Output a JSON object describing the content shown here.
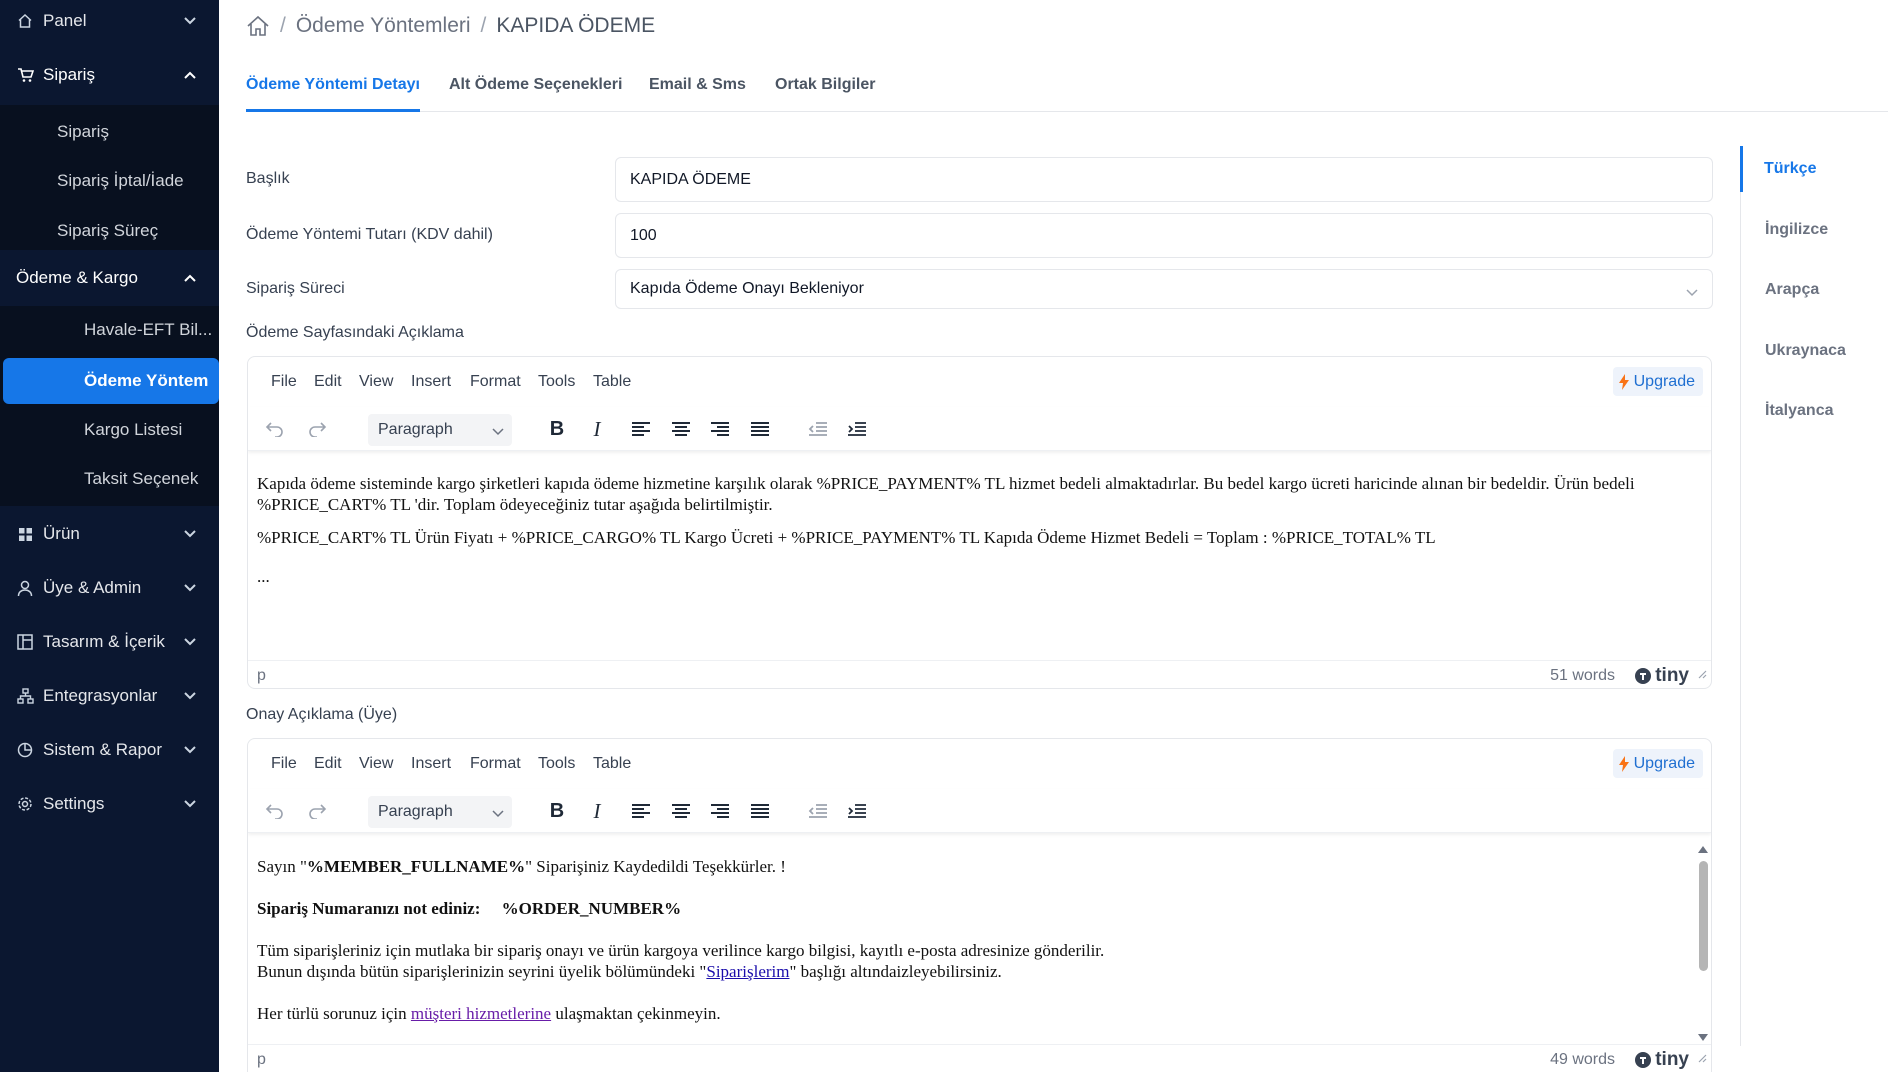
{
  "sidebar": {
    "panel": "Panel",
    "siparis": "Sipariş",
    "siparis_sub": [
      "Sipariş",
      "Sipariş İptal/İade",
      "Sipariş Süreç"
    ],
    "odeme_kargo": "Ödeme & Kargo",
    "odeme_sub": [
      "Havale-EFT Bil...",
      "Ödeme Yöntem",
      "Kargo Listesi",
      "Taksit Seçenek"
    ],
    "urun": "Ürün",
    "uye_admin": "Üye & Admin",
    "tasarim": "Tasarım & İçerik",
    "entegrasyon": "Entegrasyonlar",
    "sistem": "Sistem & Rapor",
    "settings": "Settings"
  },
  "breadcrumb": {
    "parent": "Ödeme Yöntemleri",
    "current": "KAPIDA ÖDEME",
    "sep": "/"
  },
  "tabs": [
    "Ödeme Yöntemi Detayı",
    "Alt Ödeme Seçenekleri",
    "Email & Sms",
    "Ortak Bilgiler"
  ],
  "form": {
    "baslik_label": "Başlık",
    "baslik_value": "KAPIDA ÖDEME",
    "tutar_label": "Ödeme Yöntemi Tutarı (KDV dahil)",
    "tutar_value": "100",
    "surec_label": "Sipariş Süreci",
    "surec_value": "Kapıda Ödeme Onayı Bekleniyor",
    "aciklama_label": "Ödeme Sayfasındaki Açıklama",
    "onay_label": "Onay Açıklama (Üye)"
  },
  "editor_common": {
    "menus": [
      "File",
      "Edit",
      "View",
      "Insert",
      "Format",
      "Tools",
      "Table"
    ],
    "upgrade": "Upgrade",
    "block_format": "Paragraph",
    "path": "p",
    "brand": "tiny"
  },
  "editor1": {
    "p1": "Kapıda ödeme sisteminde kargo şirketleri kapıda ödeme hizmetine karşılık olarak %PRICE_PAYMENT% TL hizmet bedeli almaktadırlar. Bu bedel kargo ücreti haricinde alınan bir bedeldir. Ürün bedeli %PRICE_CART% TL 'dir. Toplam ödeyeceğiniz tutar aşağıda belirtilmiştir.",
    "p2": "%PRICE_CART% TL Ürün Fiyatı + %PRICE_CARGO% TL Kargo Ücreti  + %PRICE_PAYMENT% TL Kapıda Ödeme Hizmet Bedeli = Toplam : %PRICE_TOTAL% TL",
    "p3": "...",
    "words": "51 words"
  },
  "editor2": {
    "l1_a": "Sayın \"",
    "l1_b": "%MEMBER_FULLNAME%",
    "l1_c": "\" Siparişiniz Kaydedildi Teşekkürler. !",
    "l2": "Sipariş Numaranızı not ediniz:     %ORDER_NUMBER%",
    "l3": "Tüm siparişleriniz için mutlaka bir sipariş onayı ve ürün kargoya verilince kargo bilgisi, kayıtlı e-posta adresinize gönderilir.",
    "l4_a": "Bunun dışında bütün siparişlerinizin seyrini üyelik bölümündeki \"",
    "l4_link": "Siparişlerim",
    "l4_b": "\" başlığı altındaizleyebilirsiniz.",
    "l5_a": "Her türlü sorunuz için ",
    "l5_link": "müşteri hizmetlerine",
    "l5_b": " ulaşmaktan çekinmeyin.",
    "words": "49 words"
  },
  "languages": [
    "Türkçe",
    "İngilizce",
    "Arapça",
    "Ukraynaca",
    "İtalyanca"
  ],
  "colors": {
    "sidebar_bg": "#0b1730",
    "accent": "#1677e8",
    "upgrade": "#1f6fd1"
  }
}
